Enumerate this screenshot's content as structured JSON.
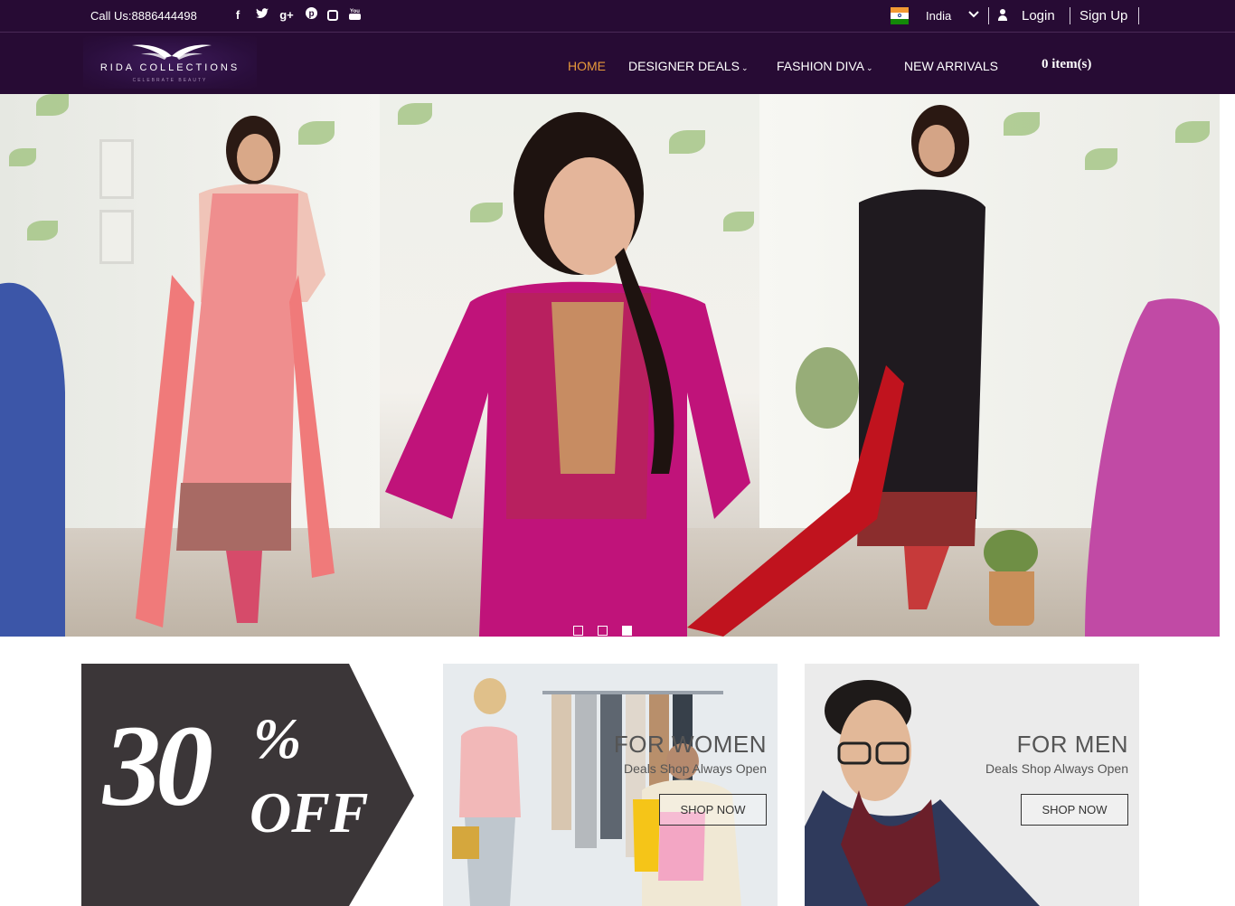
{
  "topbar": {
    "call": "Call Us:8886444498",
    "social": [
      {
        "icon": "facebook-icon",
        "glyph": "f"
      },
      {
        "icon": "twitter-icon",
        "glyph": "t"
      },
      {
        "icon": "google-plus-icon",
        "glyph": "g+"
      },
      {
        "icon": "pinterest-icon",
        "glyph": "p"
      },
      {
        "icon": "instagram-icon",
        "glyph": ""
      },
      {
        "icon": "youtube-icon",
        "glyph": "You"
      }
    ],
    "country": "India",
    "login": "Login",
    "signup": "Sign Up"
  },
  "brand": {
    "name": "RIDA COLLECTIONS",
    "tagline": "CELEBRATE BEAUTY"
  },
  "nav": {
    "items": [
      {
        "label": "HOME",
        "active": true,
        "dropdown": false
      },
      {
        "label": "DESIGNER DEALS",
        "active": false,
        "dropdown": true
      },
      {
        "label": "FASHION DIVA",
        "active": false,
        "dropdown": true
      },
      {
        "label": "NEW ARRIVALS",
        "active": false,
        "dropdown": false
      }
    ],
    "cart": "0 item(s)"
  },
  "hero": {
    "slides_total": 3,
    "active_slide": 3
  },
  "promos": {
    "offer": {
      "number": "30",
      "percent": "%",
      "word": "OFF"
    },
    "women": {
      "title": "FOR WOMEN",
      "subtitle": "Deals Shop Always Open",
      "button": "SHOP NOW"
    },
    "men": {
      "title": "FOR MEN",
      "subtitle": "Deals Shop Always Open",
      "button": "SHOP NOW"
    }
  },
  "colors": {
    "header_bg": "#270b34",
    "active_nav": "#e79a3b",
    "offer_bg": "#3b3638"
  }
}
